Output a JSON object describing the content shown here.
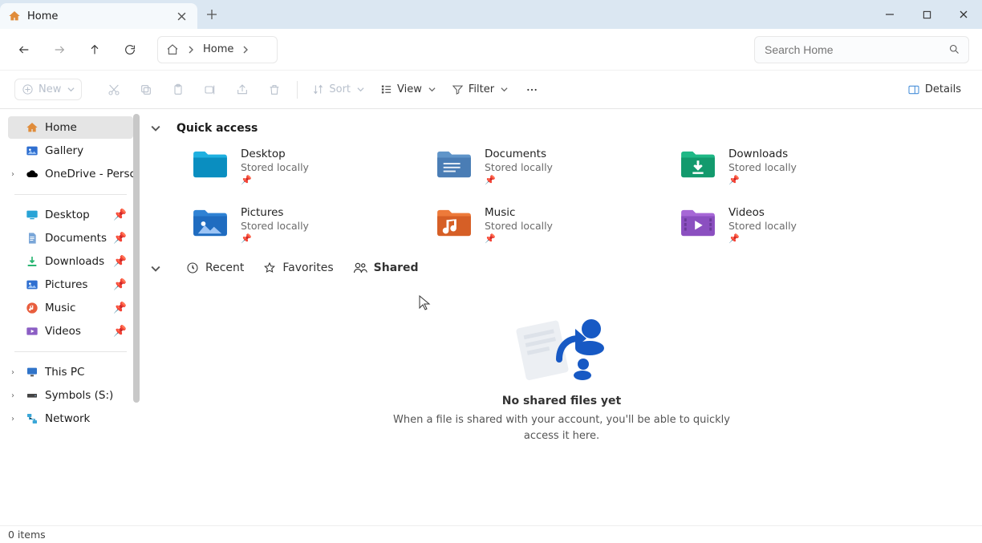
{
  "window": {
    "minimize": "",
    "maximize": "",
    "close": ""
  },
  "tab": {
    "title": "Home"
  },
  "nav": {
    "location": "Home"
  },
  "search": {
    "placeholder": "Search Home"
  },
  "toolbar": {
    "new_label": "New",
    "sort_label": "Sort",
    "view_label": "View",
    "filter_label": "Filter",
    "details_label": "Details"
  },
  "sidebar": {
    "home": "Home",
    "gallery": "Gallery",
    "onedrive": "OneDrive - Persc",
    "desktop": "Desktop",
    "documents": "Documents",
    "downloads": "Downloads",
    "pictures": "Pictures",
    "music": "Music",
    "videos": "Videos",
    "thispc": "This PC",
    "symbols": "Symbols (S:)",
    "network": "Network"
  },
  "section": {
    "quick_access": "Quick access"
  },
  "quick_access": [
    {
      "title": "Desktop",
      "sub": "Stored locally"
    },
    {
      "title": "Documents",
      "sub": "Stored locally"
    },
    {
      "title": "Downloads",
      "sub": "Stored locally"
    },
    {
      "title": "Pictures",
      "sub": "Stored locally"
    },
    {
      "title": "Music",
      "sub": "Stored locally"
    },
    {
      "title": "Videos",
      "sub": "Stored locally"
    }
  ],
  "tabs": {
    "recent": "Recent",
    "favorites": "Favorites",
    "shared": "Shared"
  },
  "empty": {
    "title": "No shared files yet",
    "body": "When a file is shared with your account, you'll be able to quickly access it here."
  },
  "status": {
    "items": "0 items"
  }
}
